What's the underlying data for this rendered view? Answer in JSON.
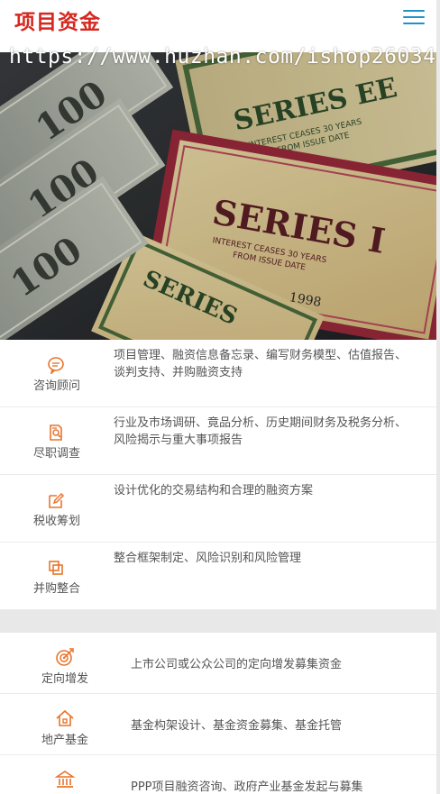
{
  "header": {
    "logo": "项目资金",
    "menu_icon": "hamburger-menu-icon"
  },
  "watermark": "https://www.huzhan.com/ishop26034",
  "banner": {
    "bond_top_title": "SERIES EE",
    "bond_top_subtitle": "INTEREST CEASES 30 YEARS",
    "bond_top_subtitle2": "FROM ISSUE DATE",
    "bond_mid_title": "SERIES I",
    "bond_mid_subtitle": "INTEREST CEASES 30 YEARS",
    "bond_mid_subtitle2": "FROM ISSUE DATE",
    "bond_year": "1998",
    "bond_bottom_title": "SERIES",
    "bill_value": "100",
    "colors": {
      "bond_red": "#9a2a3c",
      "bond_green": "#4b6b3c",
      "bond_paper": "#d9c89a"
    }
  },
  "services": [
    {
      "icon": "chat-bubble-icon",
      "name": "咨询顾问",
      "desc": "项目管理、融资信息备忘录、编写财务模型、估值报告、谈判支持、并购融资支持"
    },
    {
      "icon": "document-search-icon",
      "name": "尽职调查",
      "desc": "行业及市场调研、竟品分析、历史期间财务及税务分析、风险揭示与重大事项报告"
    },
    {
      "icon": "edit-note-icon",
      "name": "税收筹划",
      "desc": "设计优化的交易结构和合理的融资方案"
    },
    {
      "icon": "merge-squares-icon",
      "name": "并购整合",
      "desc": "整合框架制定、风险识别和风险管理"
    }
  ],
  "funds": [
    {
      "icon": "target-icon",
      "name": "定向增发",
      "desc": "上市公司或公众公司的定向增发募集资金"
    },
    {
      "icon": "house-icon",
      "name": "地产基金",
      "desc": "基金构架设计、基金资金募集、基金托管"
    },
    {
      "icon": "bank-building-icon",
      "name": "",
      "desc": "PPP项目融资咨询、政府产业基金发起与募集"
    }
  ],
  "accent_color": "#e8742c",
  "brand_color": "#d6281f",
  "menu_color": "#1f93c9"
}
